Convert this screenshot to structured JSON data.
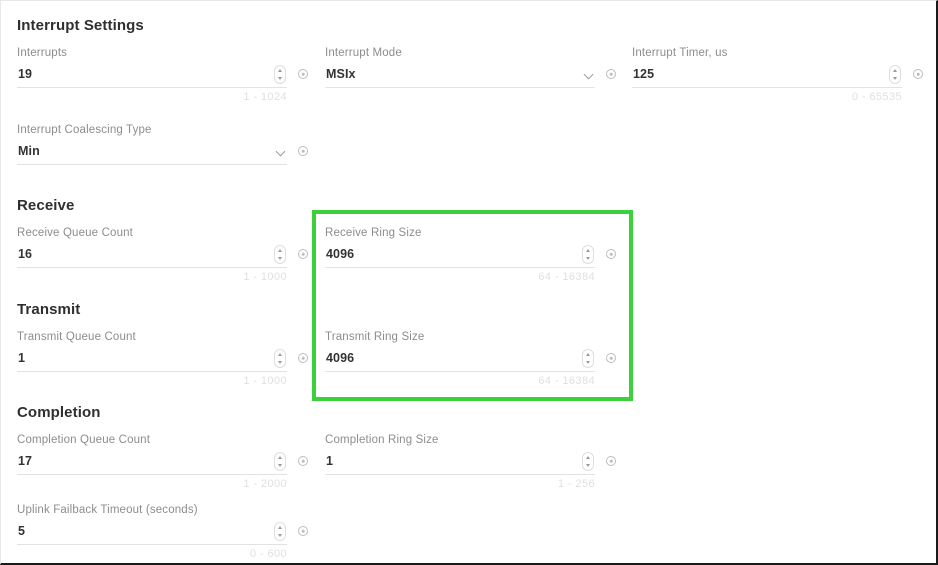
{
  "sections": [
    {
      "id": "interrupt-settings",
      "title": "Interrupt Settings"
    },
    {
      "id": "receive",
      "title": "Receive"
    },
    {
      "id": "transmit",
      "title": "Transmit"
    },
    {
      "id": "completion",
      "title": "Completion"
    }
  ],
  "fields": [
    {
      "id": "interrupts",
      "label": "Interrupts",
      "value": "19",
      "hint": "1 - 1024",
      "control": "stepper",
      "info": true
    },
    {
      "id": "interrupt-mode",
      "label": "Interrupt Mode",
      "value": "MSIx",
      "hint": "",
      "control": "dropdown",
      "info": true
    },
    {
      "id": "interrupt-timer-us",
      "label": "Interrupt Timer, us",
      "value": "125",
      "hint": "0 - 65535",
      "control": "stepper",
      "info": true
    },
    {
      "id": "interrupt-coalescing-type",
      "label": "Interrupt Coalescing Type",
      "value": "Min",
      "hint": "",
      "control": "dropdown",
      "info": true
    },
    {
      "id": "receive-queue-count",
      "label": "Receive Queue Count",
      "value": "16",
      "hint": "1 - 1000",
      "control": "stepper",
      "info": true
    },
    {
      "id": "receive-ring-size",
      "label": "Receive Ring Size",
      "value": "4096",
      "hint": "64 - 16384",
      "control": "stepper",
      "info": true
    },
    {
      "id": "transmit-queue-count",
      "label": "Transmit Queue Count",
      "value": "1",
      "hint": "1 - 1000",
      "control": "stepper",
      "info": true
    },
    {
      "id": "transmit-ring-size",
      "label": "Transmit Ring Size",
      "value": "4096",
      "hint": "64 - 16384",
      "control": "stepper",
      "info": true
    },
    {
      "id": "completion-queue-count",
      "label": "Completion Queue Count",
      "value": "17",
      "hint": "1 - 2000",
      "control": "stepper",
      "info": true
    },
    {
      "id": "completion-ring-size",
      "label": "Completion Ring Size",
      "value": "1",
      "hint": "1 - 256",
      "control": "stepper",
      "info": true
    },
    {
      "id": "uplink-failback-timeout",
      "label": "Uplink Failback Timeout (seconds)",
      "value": "5",
      "hint": "0 - 600",
      "control": "stepper",
      "info": true
    }
  ],
  "highlight": {
    "color": "#3ad13a",
    "annotates": [
      "receive-ring-size",
      "transmit-ring-size"
    ]
  }
}
